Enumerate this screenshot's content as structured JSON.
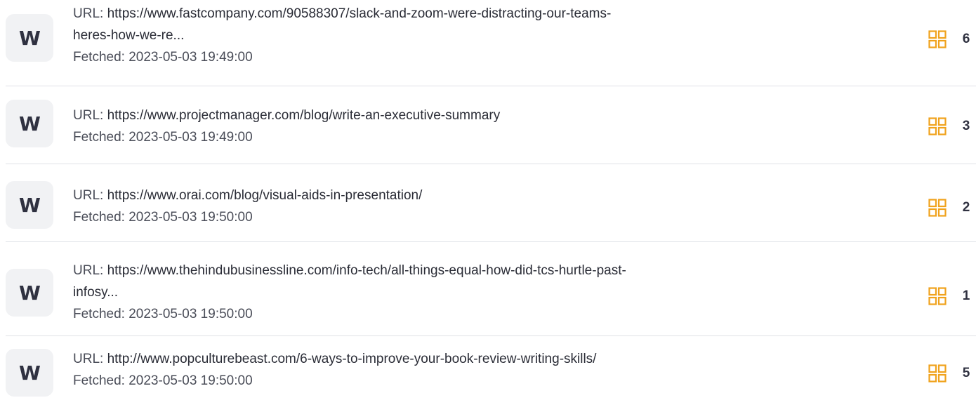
{
  "colors": {
    "accent": "#f0a21c",
    "divider": "#dfe1e6",
    "badge_bg": "#f1f2f4"
  },
  "rows": [
    {
      "badge": "W",
      "url_label": "URL: ",
      "url_line1": "https://www.fastcompany.com/90588307/slack-and-zoom-were-distracting-our-teams-",
      "url_line2": "heres-how-we-re...",
      "fetched_label": "Fetched: ",
      "fetched_value": "2023-05-03 19:49:00",
      "icon": "grid-icon",
      "count": "6"
    },
    {
      "badge": "W",
      "url_label": "URL: ",
      "url_line1": "https://www.projectmanager.com/blog/write-an-executive-summary",
      "url_line2": "",
      "fetched_label": "Fetched: ",
      "fetched_value": "2023-05-03 19:49:00",
      "icon": "grid-icon",
      "count": "3"
    },
    {
      "badge": "W",
      "url_label": "URL: ",
      "url_line1": "https://www.orai.com/blog/visual-aids-in-presentation/",
      "url_line2": "",
      "fetched_label": "Fetched: ",
      "fetched_value": "2023-05-03 19:50:00",
      "icon": "grid-icon",
      "count": "2"
    },
    {
      "badge": "W",
      "url_label": "URL: ",
      "url_line1": "https://www.thehindubusinessline.com/info-tech/all-things-equal-how-did-tcs-hurtle-past-",
      "url_line2": "infosy...",
      "fetched_label": "Fetched: ",
      "fetched_value": "2023-05-03 19:50:00",
      "icon": "grid-icon",
      "count": "1"
    },
    {
      "badge": "W",
      "url_label": "URL: ",
      "url_line1": "http://www.popculturebeast.com/6-ways-to-improve-your-book-review-writing-skills/",
      "url_line2": "",
      "fetched_label": "Fetched: ",
      "fetched_value": "2023-05-03 19:50:00",
      "icon": "grid-icon",
      "count": "5"
    }
  ]
}
